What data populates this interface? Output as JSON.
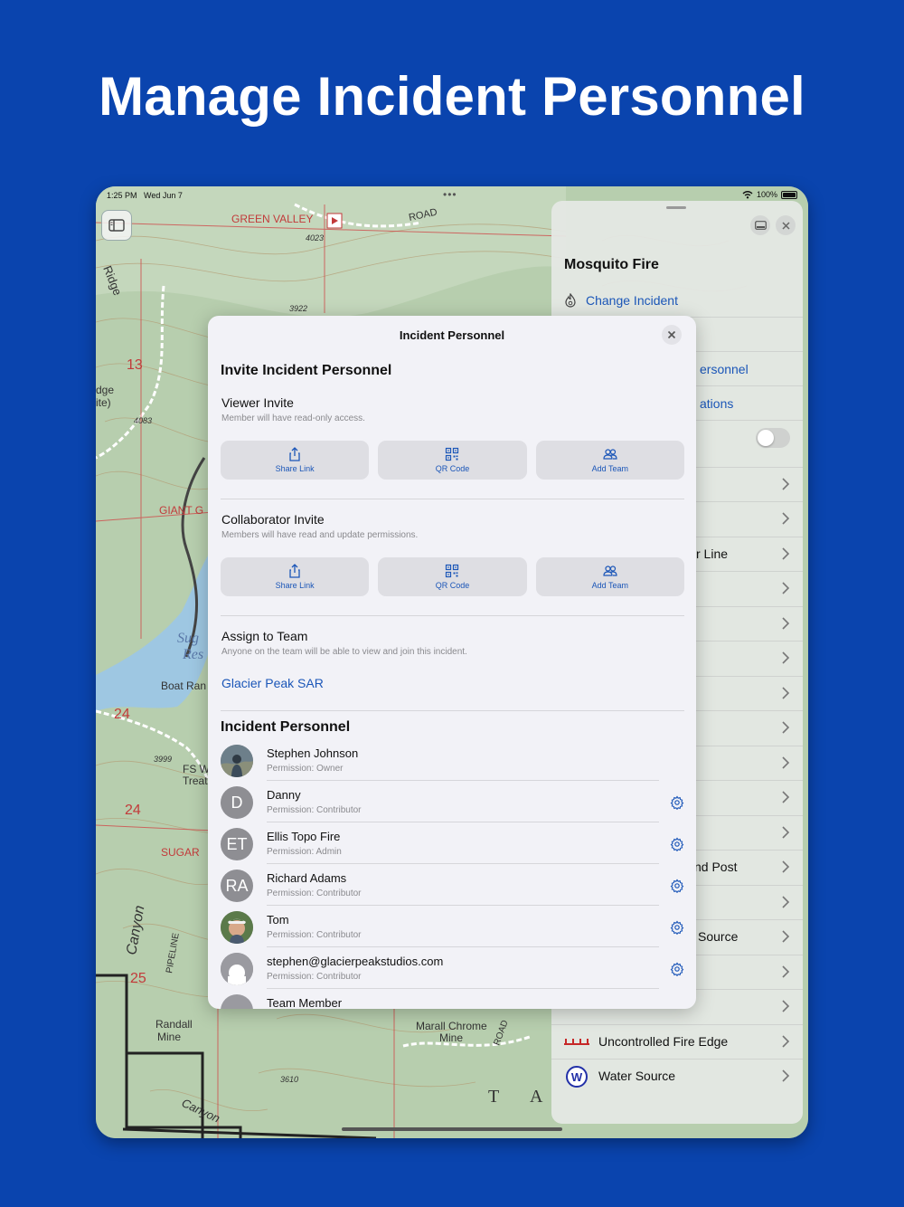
{
  "headline": "Manage Incident Personnel",
  "status": {
    "time": "1:25 PM",
    "date": "Wed Jun 7",
    "battery": "100%"
  },
  "map_labels": {
    "green_valley": "GREEN VALLEY",
    "road": "ROAD",
    "ridge": "Ridge",
    "n4023": "4023",
    "n3922": "3922",
    "n13": "13",
    "n4083": "4083",
    "edge_site": "dge",
    "edge_site2": "ite)",
    "giant": "GIANT G",
    "sug": "Sug",
    "res": "Res",
    "boat": "Boat Ran",
    "n24a": "24",
    "n3999": "3999",
    "fs": "FS W",
    "treat": "Treat",
    "n24b": "24",
    "sugar": "SUGAR",
    "canyon": "Canyon",
    "pipeline": "PIPELINE",
    "n25": "25",
    "randall": "Randall",
    "mine": "Mine",
    "n3610": "3610",
    "canyon2": "Canyon",
    "marall": "Marall Chrome",
    "mine2": "Mine",
    "road2": "ROAD",
    "t": "T",
    "a": "A"
  },
  "right_panel": {
    "title": "Mosquito Fire",
    "change_incident": "Change Incident",
    "rows": [
      {
        "label": "",
        "blue": false
      },
      {
        "label": "ersonnel",
        "blue": true
      },
      {
        "label": "ations",
        "blue": true
      }
    ],
    "items": [
      {
        "label": ""
      },
      {
        "label": ""
      },
      {
        "label": "r Line"
      },
      {
        "label": ""
      },
      {
        "label": ""
      },
      {
        "label": ""
      },
      {
        "label": ""
      },
      {
        "label": ""
      },
      {
        "label": ""
      },
      {
        "label": ""
      },
      {
        "label": ""
      },
      {
        "label": "nd Post"
      },
      {
        "label": ""
      },
      {
        "label": "Source"
      },
      {
        "label": ""
      },
      {
        "label": ""
      },
      {
        "label": "Uncontrolled Fire Edge"
      },
      {
        "label": "Water Source"
      }
    ]
  },
  "modal": {
    "header": "Incident Personnel",
    "invite_title": "Invite Incident Personnel",
    "viewer": {
      "title": "Viewer Invite",
      "note": "Member will have read-only access.",
      "buttons": [
        "Share Link",
        "QR Code",
        "Add Team"
      ]
    },
    "collaborator": {
      "title": "Collaborator Invite",
      "note": "Members will have read and update permissions.",
      "buttons": [
        "Share Link",
        "QR Code",
        "Add Team"
      ]
    },
    "assign": {
      "title": "Assign to Team",
      "note": "Anyone on the team will be able to view and join this incident.",
      "team": "Glacier Peak SAR"
    },
    "personnel_title": "Incident Personnel",
    "personnel": [
      {
        "name": "Stephen Johnson",
        "permission": "Permission: Owner",
        "initials": ""
      },
      {
        "name": "Danny",
        "permission": "Permission: Contributor",
        "initials": "D"
      },
      {
        "name": "Ellis Topo Fire",
        "permission": "Permission: Admin",
        "initials": "ET"
      },
      {
        "name": "Richard Adams",
        "permission": "Permission: Contributor",
        "initials": "RA"
      },
      {
        "name": "Tom",
        "permission": "Permission: Contributor",
        "initials": ""
      },
      {
        "name": "stephen@glacierpeakstudios.com",
        "permission": "Permission: Contributor",
        "initials": ""
      },
      {
        "name": "Team Member",
        "permission": "",
        "initials": ""
      }
    ]
  }
}
